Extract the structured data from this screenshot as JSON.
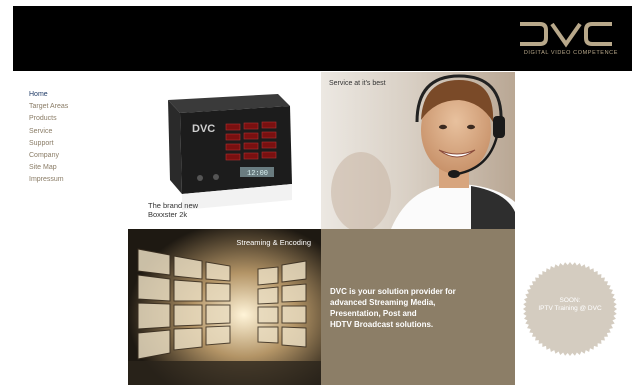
{
  "header": {
    "logo_text": "DVC",
    "tagline": "DIGITAL VIDEO COMPETENCE"
  },
  "nav": {
    "items": [
      {
        "label": "Home"
      },
      {
        "label": "Target Areas"
      },
      {
        "label": "Products"
      },
      {
        "label": "Service"
      },
      {
        "label": "Support"
      },
      {
        "label": "Company"
      },
      {
        "label": "Site Map"
      },
      {
        "label": "Impressum"
      }
    ]
  },
  "product": {
    "brand": "DVC",
    "display": "12:00",
    "caption_line1": "The brand new",
    "caption_line2": "Boxxster 2k"
  },
  "service": {
    "label": "Service at it's best"
  },
  "streaming": {
    "label": "Streaming & Encoding"
  },
  "solution": {
    "line1": "DVC is your solution provider for",
    "line2": "advanced Streaming Media,",
    "line3": "Presentation, Post and",
    "line4": "HDTV Broadcast solutions."
  },
  "soon": {
    "line1": "SOON:",
    "line2": "IPTV Training @ DVC"
  },
  "colors": {
    "header_bg": "#000000",
    "logo_gold": "#b8a88a",
    "nav_text": "#8a7c66",
    "nav_active": "#1f3a66",
    "solution_bg": "#8c7e67",
    "seal": "#d4ccc0"
  }
}
